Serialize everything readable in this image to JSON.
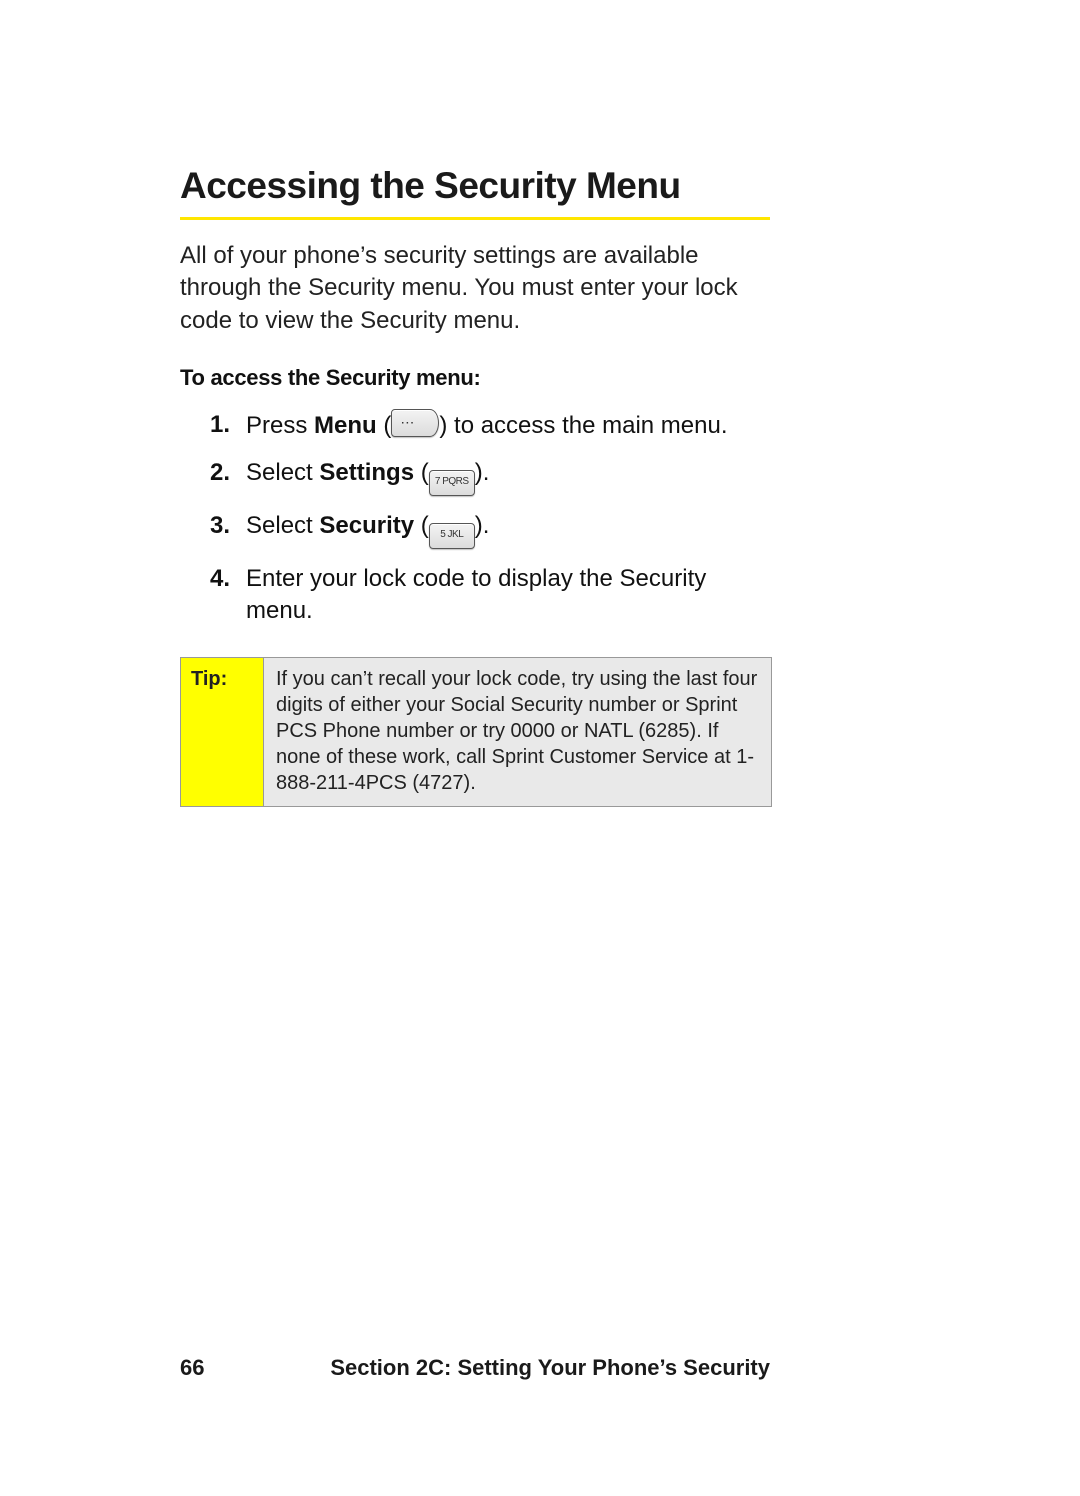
{
  "title": "Accessing the Security Menu",
  "intro": "All of your phone’s security settings are available through the Security menu. You must enter your lock code to view the Security menu.",
  "subhead": "To access the Security menu:",
  "steps": [
    {
      "num": "1.",
      "pre": "Press ",
      "bold": "Menu",
      "post_open": " (",
      "key": "menu-key",
      "post_close": ") to access the main menu."
    },
    {
      "num": "2.",
      "pre": "Select ",
      "bold": "Settings",
      "post_open": " (",
      "key": "7 PQRS",
      "post_close": ")."
    },
    {
      "num": "3.",
      "pre": "Select ",
      "bold": "Security",
      "post_open": " (",
      "key": "5 JKL",
      "post_close": ")."
    },
    {
      "num": "4.",
      "pre": "Enter your lock code to display the Security menu.",
      "bold": "",
      "post_open": "",
      "key": "",
      "post_close": ""
    }
  ],
  "tip": {
    "label": "Tip:",
    "body": "If you can’t recall your lock code, try using the last four digits of either your Social Security number or Sprint PCS Phone number or try 0000 or NATL (6285). If none of these work, call Sprint Customer Service at 1-888-211-4PCS (4727)."
  },
  "footer": {
    "page": "66",
    "section": "Section 2C: Setting Your Phone’s Security"
  }
}
